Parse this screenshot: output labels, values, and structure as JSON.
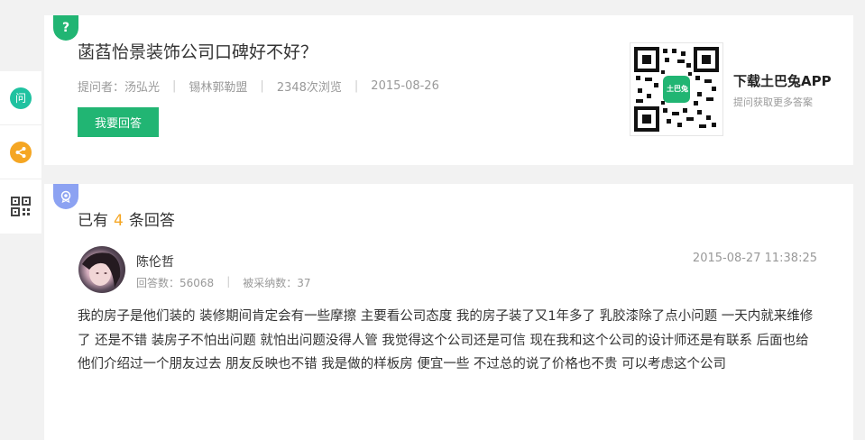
{
  "sidebar": {
    "ask_label": "问",
    "share_label": "<",
    "qr_label": "二维码"
  },
  "question": {
    "badge": "?",
    "title": "菡萏怡景装饰公司口碑好不好？",
    "asker": "提问者：汤弘光",
    "location": "锡林郭勒盟",
    "views": "2348次浏览",
    "date": "2015-08-26",
    "answer_button": "我要回答",
    "app": {
      "qr_logo": "土巴兔",
      "title": "下载土巴兔APP",
      "subtitle": "提问获取更多答案"
    }
  },
  "answers": {
    "badge": "★",
    "count_prefix": "已有",
    "count": "4",
    "count_suffix": "条回答",
    "items": [
      {
        "user": "陈伦哲",
        "answer_count": "回答数：56068",
        "adopted_count": "被采纳数：37",
        "time": "2015-08-27 11:38:25",
        "text": "我的房子是他们装的 装修期间肯定会有一些摩擦 主要看公司态度 我的房子装了又1年多了 乳胶漆除了点小问题 一天内就来维修了 还是不错 装房子不怕出问题 就怕出问题没得人管 我觉得这个公司还是可信 现在我和这个公司的设计师还是有联系 后面也给他们介绍过一个朋友过去 朋友反映也不错 我是做的样板房 便宜一些 不过总的说了价格也不贵 可以考虑这个公司"
      }
    ]
  },
  "colors": {
    "green": "#21b573",
    "teal": "#1fc2a0",
    "orange": "#f5a623",
    "badge_blue": "#8ca2f2"
  }
}
